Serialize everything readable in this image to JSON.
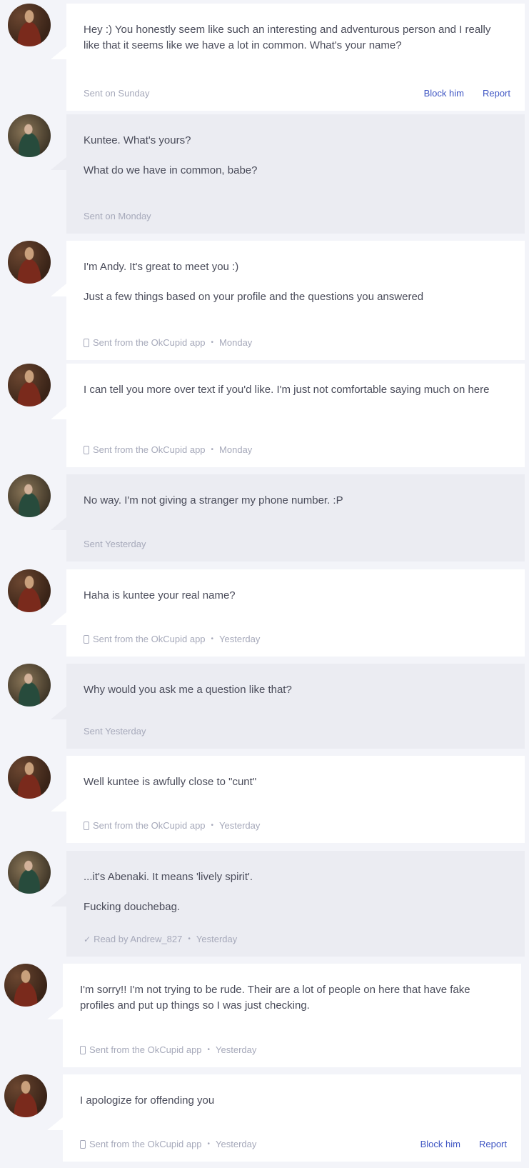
{
  "messages": [
    {
      "sender": "him",
      "paragraphs": [
        "Hey :) You honestly seem like such an interesting and adventurous person and I really like that it seems like we have a lot in common. What's your name?"
      ],
      "footer": {
        "source": "",
        "when": "Sent on Sunday",
        "icon": ""
      },
      "actions": {
        "block": "Block him",
        "report": "Report"
      }
    },
    {
      "sender": "her",
      "paragraphs": [
        "Kuntee. What's yours?",
        "What do we have in common, babe?"
      ],
      "footer": {
        "source": "",
        "when": "Sent on Monday",
        "icon": ""
      }
    },
    {
      "sender": "him",
      "paragraphs": [
        "I'm Andy. It's great to meet you :)",
        "Just a few things based on your profile and the questions you answered"
      ],
      "footer": {
        "source": "Sent from the OkCupid app",
        "when": "Monday",
        "icon": "phone-icon"
      }
    },
    {
      "sender": "him",
      "paragraphs": [
        "I can tell you more over text if you'd like. I'm just not comfortable saying much on here"
      ],
      "footer": {
        "source": "Sent from the OkCupid app",
        "when": "Monday",
        "icon": "phone-icon"
      }
    },
    {
      "sender": "her",
      "paragraphs": [
        "No way. I'm not giving a stranger my phone number. :P"
      ],
      "footer": {
        "source": "",
        "when": "Sent Yesterday",
        "icon": ""
      }
    },
    {
      "sender": "him",
      "paragraphs": [
        "Haha is kuntee your real name?"
      ],
      "footer": {
        "source": "Sent from the OkCupid app",
        "when": "Yesterday",
        "icon": "phone-icon"
      }
    },
    {
      "sender": "her",
      "paragraphs": [
        "Why would you ask me a question like that?"
      ],
      "footer": {
        "source": "",
        "when": "Sent Yesterday",
        "icon": ""
      }
    },
    {
      "sender": "him",
      "paragraphs": [
        "Well kuntee is awfully close to \"cunt\""
      ],
      "footer": {
        "source": "Sent from the OkCupid app",
        "when": "Yesterday",
        "icon": "phone-icon"
      }
    },
    {
      "sender": "her",
      "paragraphs": [
        "...it's Abenaki. It means 'lively spirit'.",
        "Fucking douchebag."
      ],
      "footer": {
        "source": "Read by Andrew_827",
        "when": "Yesterday",
        "icon": "check-icon"
      }
    },
    {
      "sender": "him",
      "paragraphs": [
        "I'm sorry!! I'm not trying to be rude. Their are a lot of people on here that have fake profiles and put up things so I was just checking."
      ],
      "footer": {
        "source": "Sent from the OkCupid app",
        "when": "Yesterday",
        "icon": "phone-icon"
      }
    },
    {
      "sender": "him",
      "paragraphs": [
        "I apologize for offending you"
      ],
      "footer": {
        "source": "Sent from the OkCupid app",
        "when": "Yesterday",
        "icon": "phone-icon"
      },
      "actions": {
        "block": "Block him",
        "report": "Report"
      }
    }
  ],
  "colors": {
    "page_bg": "#f3f4f9",
    "his_bubble": "#ffffff",
    "her_bubble": "#ebecf2",
    "link": "#3e55c3",
    "meta_text": "#a6a9ba"
  }
}
